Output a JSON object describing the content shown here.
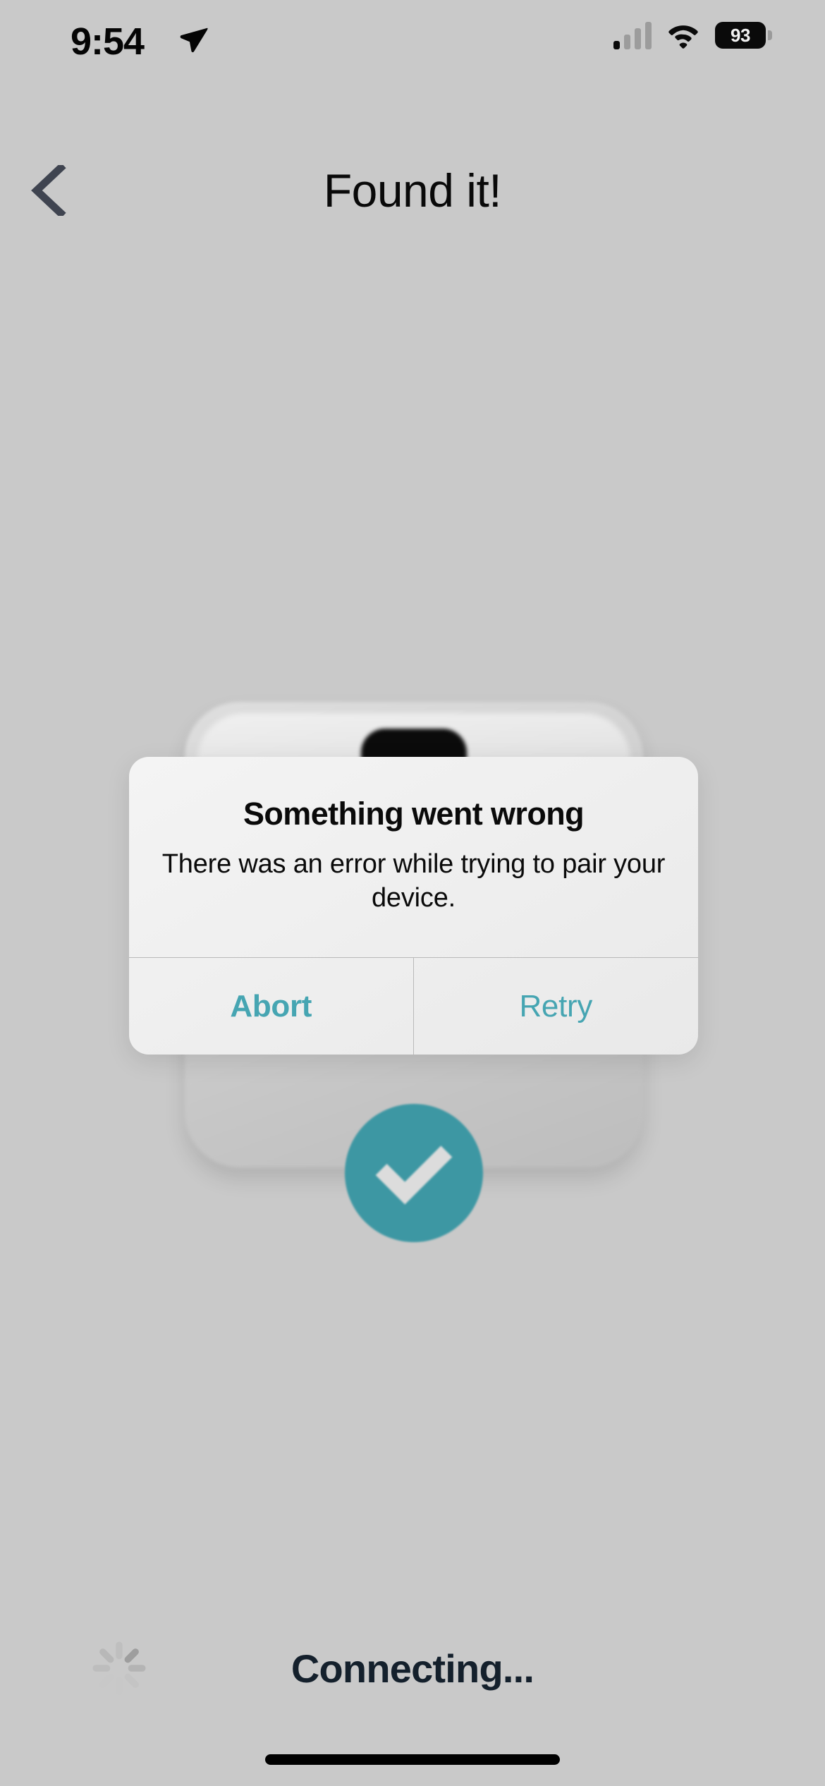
{
  "status_bar": {
    "time": "9:54",
    "location_arrow_icon": "location-arrow-icon",
    "signal_icon": "cellular-signal-icon",
    "wifi_icon": "wifi-icon",
    "battery_level": "93",
    "battery_icon": "battery-icon"
  },
  "header": {
    "back_icon": "chevron-left-icon",
    "title": "Found it!"
  },
  "illustration": {
    "device_name": "paired-device-graphic",
    "check_icon": "check-circle-icon",
    "accent_color": "#3d97a3"
  },
  "alert": {
    "title": "Something went wrong",
    "message": "There was an error while trying to pair your device.",
    "buttons": [
      {
        "label": "Abort",
        "name": "abort",
        "emphasis": "bold"
      },
      {
        "label": "Retry",
        "name": "retry",
        "emphasis": "regular"
      }
    ],
    "button_color": "#46a5b2"
  },
  "footer": {
    "spinner_icon": "loading-spinner-icon",
    "status_text": "Connecting..."
  },
  "colors": {
    "background": "#c9c9c9",
    "accent_teal": "#3d97a3",
    "link_teal": "#46a5b2",
    "title_text": "#090909",
    "footer_text": "#14202c",
    "back_chevron": "#3f4450"
  }
}
